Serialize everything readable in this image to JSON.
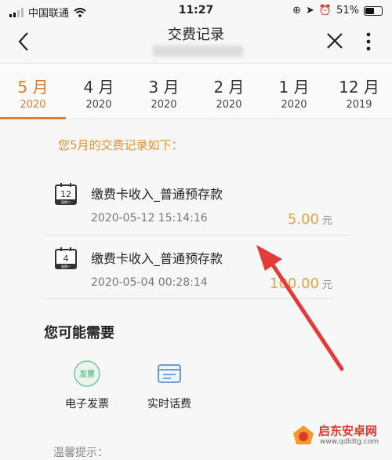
{
  "status_bar": {
    "carrier": "中国联通",
    "time": "11:27",
    "battery": "51%",
    "battery_level": 0.51
  },
  "nav": {
    "title": "交费记录"
  },
  "tabs": [
    {
      "month": "5 月",
      "year": "2020",
      "active": true
    },
    {
      "month": "4 月",
      "year": "2020"
    },
    {
      "month": "3 月",
      "year": "2020"
    },
    {
      "month": "2 月",
      "year": "2020"
    },
    {
      "month": "1 月",
      "year": "2020"
    },
    {
      "month": "12 月",
      "year": "2019"
    }
  ],
  "records_intro": "您5月的交费记录如下：",
  "records": [
    {
      "day": "12",
      "weekday": "星期二",
      "desc": "缴费卡收入_普通预存款",
      "datetime": "2020-05-12 15:14:16",
      "amount": "5.00",
      "unit": "元"
    },
    {
      "day": "4",
      "weekday": "星期一",
      "desc": "缴费卡收入_普通预存款",
      "datetime": "2020-05-04 00:28:14",
      "amount": "100.00",
      "unit": "元"
    }
  ],
  "section_title": "您可能需要",
  "services": [
    {
      "label": "电子发票",
      "icon_text": "发票",
      "icon": "invoice-icon"
    },
    {
      "label": "实时话费",
      "icon": "bill-card-icon"
    }
  ],
  "tip": "温馨提示：",
  "watermark": {
    "name": "启东安卓网",
    "url": "www.qdldtg.com"
  },
  "colors": {
    "accent": "#e07b2c",
    "amount": "#e0a24a",
    "arrow": "#e33b3b"
  }
}
